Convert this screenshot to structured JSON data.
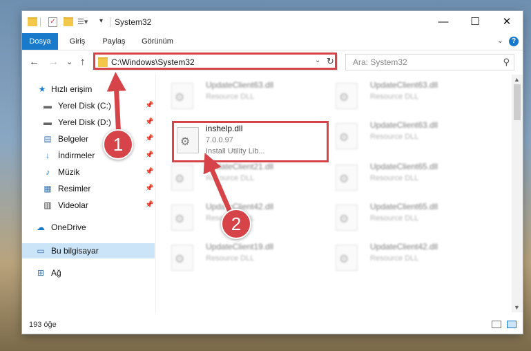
{
  "window": {
    "title": "System32",
    "minimize_glyph": "—",
    "maximize_glyph": "☐",
    "close_glyph": "✕"
  },
  "ribbon": {
    "tabs": [
      "Dosya",
      "Giriş",
      "Paylaş",
      "Görünüm"
    ],
    "active_tab": "Dosya",
    "collapse_glyph": "⌄",
    "help_glyph": "?"
  },
  "navigation": {
    "back_glyph": "←",
    "forward_glyph": "→",
    "recent_glyph": "⌄",
    "up_glyph": "↑",
    "address": "C:\\Windows\\System32",
    "address_dropdown_glyph": "⌄",
    "refresh_glyph": "↻",
    "search_placeholder": "Ara: System32",
    "search_glyph": "⚲"
  },
  "sidebar": {
    "items": [
      {
        "label": "Hızlı erişim",
        "icon": "star-icon",
        "glyph": "★",
        "pinned": false
      },
      {
        "label": "Yerel Disk (C:)",
        "icon": "drive-icon",
        "glyph": "▬",
        "pinned": true
      },
      {
        "label": "Yerel Disk (D:)",
        "icon": "drive-icon",
        "glyph": "▬",
        "pinned": true
      },
      {
        "label": "Belgeler",
        "icon": "documents-icon",
        "glyph": "▤",
        "pinned": true
      },
      {
        "label": "İndirmeler",
        "icon": "download-icon",
        "glyph": "↓",
        "pinned": true
      },
      {
        "label": "Müzik",
        "icon": "music-icon",
        "glyph": "♪",
        "pinned": true
      },
      {
        "label": "Resimler",
        "icon": "pictures-icon",
        "glyph": "▦",
        "pinned": true
      },
      {
        "label": "Videolar",
        "icon": "video-icon",
        "glyph": "▥",
        "pinned": true
      },
      {
        "label": "OneDrive",
        "icon": "cloud-icon",
        "glyph": "☁",
        "pinned": false
      },
      {
        "label": "Bu bilgisayar",
        "icon": "computer-icon",
        "glyph": "▭",
        "pinned": false,
        "selected": true
      },
      {
        "label": "Ağ",
        "icon": "network-icon",
        "glyph": "⊞",
        "pinned": false
      }
    ],
    "pin_glyph": "📌"
  },
  "files": {
    "left_column": [
      {
        "name": "UpdateClient63.dll",
        "type": "Resource DLL"
      },
      {
        "name": "inshelp.dll",
        "version": "7.0.0.97",
        "description": "Install Utility Lib..."
      },
      {
        "name": "UpdateClient21.dll",
        "type": "Resource DLL"
      },
      {
        "name": "UpdateClient42.dll",
        "type": "Resource DLL"
      },
      {
        "name": "UpdateClient19.dll",
        "type": "Resource DLL"
      }
    ],
    "right_column": [
      {
        "name": "UpdateClient63.dll",
        "type": "Resource DLL"
      },
      {
        "name": "UpdateClient63.dll",
        "type": "Resource DLL"
      },
      {
        "name": "UpdateClient65.dll",
        "type": "Resource DLL"
      },
      {
        "name": "UpdateClient65.dll",
        "type": "Resource DLL"
      },
      {
        "name": "UpdateClient42.dll",
        "type": "Resource DLL"
      }
    ],
    "gear_glyph": "⚙"
  },
  "status": {
    "item_count": "193 öğe"
  },
  "annotations": {
    "step1": "1",
    "step2": "2",
    "highlight_color": "#d6444a"
  },
  "colors": {
    "accent": "#1979ca",
    "selected_bg": "#cce4f7"
  }
}
